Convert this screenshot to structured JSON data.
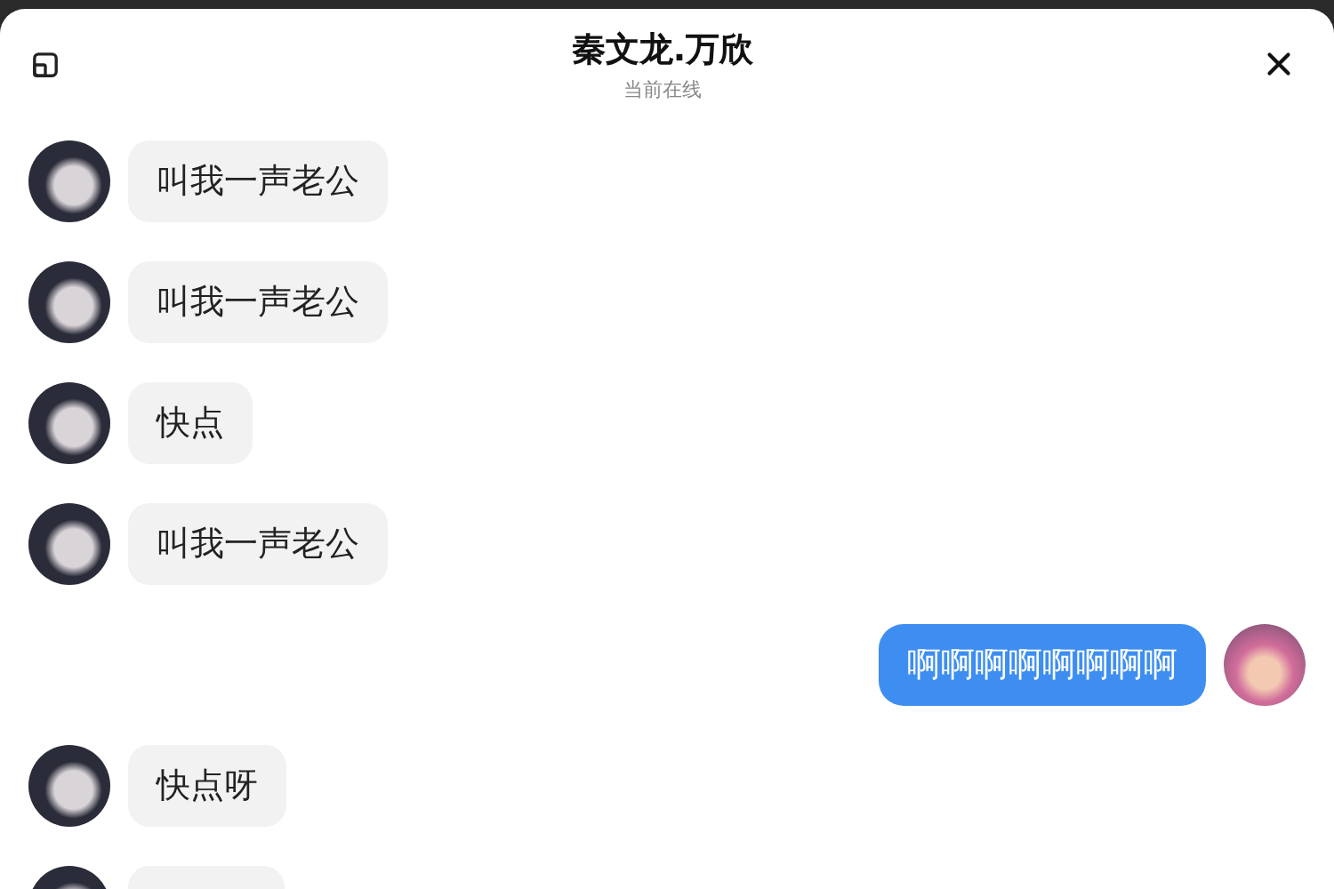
{
  "header": {
    "title": "秦文龙.万欣",
    "subtitle": "当前在线"
  },
  "messages": [
    {
      "kind": "received",
      "text": "叫我一声老公"
    },
    {
      "kind": "received",
      "text": "叫我一声老公"
    },
    {
      "kind": "received",
      "text": "快点"
    },
    {
      "kind": "received",
      "text": "叫我一声老公"
    },
    {
      "kind": "sent",
      "text": "啊啊啊啊啊啊啊啊"
    },
    {
      "kind": "received",
      "text": "快点呀"
    },
    {
      "kind": "received_cut"
    }
  ]
}
